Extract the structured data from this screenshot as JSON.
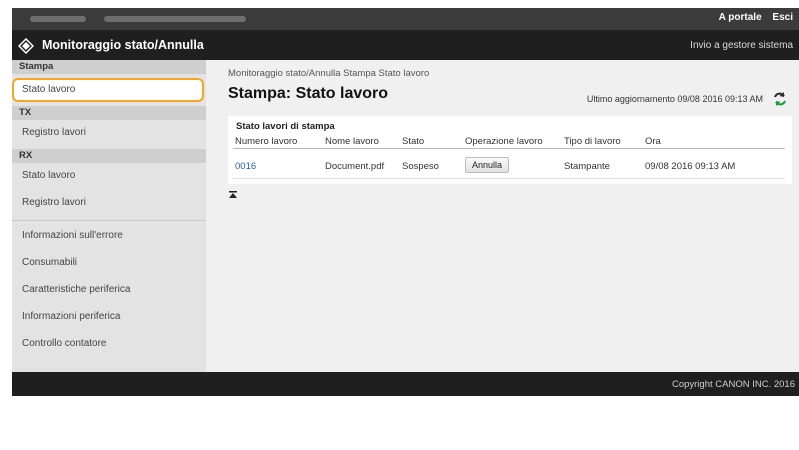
{
  "header": {
    "links": [
      "A portale",
      "Esci"
    ],
    "app_title": "Monitoraggio stato/Annulla",
    "manager_link": "Invio a gestore sistema"
  },
  "sidebar": {
    "sections": [
      {
        "title": "Stampa",
        "items": [
          "Stato lavoro"
        ]
      },
      {
        "title": "TX",
        "items": [
          "Registro lavori"
        ]
      },
      {
        "title": "RX",
        "items": [
          "Stato lavoro",
          "Registro lavori"
        ]
      }
    ],
    "selected": "Stato lavoro",
    "other_items": [
      "Informazioni sull'errore",
      "Consumabili",
      "Caratteristiche periferica",
      "Informazioni periferica",
      "Controllo contatore"
    ]
  },
  "main": {
    "breadcrumb": [
      "Monitoraggio stato/Annulla",
      "Stampa",
      "Stato lavoro"
    ],
    "page_title": "Stampa: Stato lavoro",
    "last_updated": "Ultimo aggiornamento 09/08 2016 09:13 AM",
    "panel_title": "Stato lavori di stampa",
    "columns": [
      "Numero lavoro",
      "Nome lavoro",
      "Stato",
      "Operazione lavoro",
      "Tipo di lavoro",
      "Ora"
    ],
    "rows": [
      {
        "number": "0016",
        "name": "Document.pdf",
        "status": "Sospeso",
        "action": "Annulla",
        "type": "Stampante",
        "time": "09/08 2016 09:13 AM"
      }
    ]
  },
  "footer": {
    "copyright": "Copyright CANON INC. 2016"
  },
  "colors": {
    "accent_highlight": "#f5a623",
    "link": "#2a5db0",
    "title_bar": "#1f1f1f",
    "sidebar_bg": "#e3e3e3"
  },
  "icons": [
    "canon-logo-icon",
    "refresh-icon",
    "back-to-top-icon"
  ]
}
